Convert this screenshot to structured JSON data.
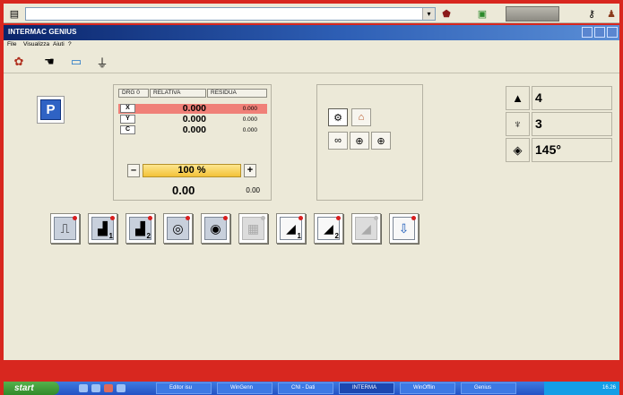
{
  "topbar": {
    "icons": [
      "tools-icon",
      "dropdown-arrow-icon",
      "shield-icon",
      "green-square-icon",
      "slash-icon",
      "key-icon",
      "user-icon"
    ],
    "address_value": ""
  },
  "window": {
    "title": "INTERMAC GENIUS"
  },
  "menu": {
    "file": "File",
    "view": "Visualizza",
    "help": "Aiuti",
    "q": "?"
  },
  "axes": {
    "headers": [
      "DRG 0",
      "RELATIVA",
      "RESIDUA"
    ],
    "rows": [
      {
        "axis": "X",
        "relative": "0.000",
        "residual": "0.000",
        "highlighted": true
      },
      {
        "axis": "Y",
        "relative": "0.000",
        "residual": "0.000",
        "highlighted": false
      },
      {
        "axis": "C",
        "relative": "0.000",
        "residual": "0.000",
        "highlighted": false
      }
    ]
  },
  "override": {
    "minus": "–",
    "plus": "+",
    "percent": "100 %",
    "value_big": "0.00",
    "value_small": "0.00"
  },
  "info": [
    {
      "icon": "spindle-icon",
      "value": "4"
    },
    {
      "icon": "tool-holder-icon",
      "value": "3"
    },
    {
      "icon": "angle-icon",
      "value": "145°"
    }
  ],
  "park_button": "P",
  "tool_buttons": [
    {
      "name": "clamps-button",
      "icon": "clamps-icon",
      "num": "",
      "dim": false
    },
    {
      "name": "vacuum-1-button",
      "icon": "vacuum-cup-icon",
      "num": "1",
      "dim": false
    },
    {
      "name": "vacuum-2-button",
      "icon": "vacuum-cup-icon",
      "num": "2",
      "dim": false
    },
    {
      "name": "pump-button",
      "icon": "pump-icon",
      "num": "",
      "dim": false
    },
    {
      "name": "pump-2-button",
      "icon": "pump-icon",
      "num": "",
      "dim": false
    },
    {
      "name": "grey-tool-button",
      "icon": "block-icon",
      "num": "",
      "dim": true
    },
    {
      "name": "tool-1-button",
      "icon": "cutter-icon",
      "num": "1",
      "dim": false
    },
    {
      "name": "tool-2-button",
      "icon": "cutter-icon",
      "num": "2",
      "dim": false
    },
    {
      "name": "tool-3-button",
      "icon": "cutter-icon",
      "num": "",
      "dim": true
    },
    {
      "name": "probe-button",
      "icon": "probe-icon",
      "num": "",
      "dim": false
    }
  ],
  "taskbar": {
    "start": "start",
    "items": [
      "Editor isu",
      "WinGenn",
      "CNI - Dati",
      "INTERMA",
      "WinOfflin",
      "Genius"
    ],
    "clock": "16.26"
  }
}
